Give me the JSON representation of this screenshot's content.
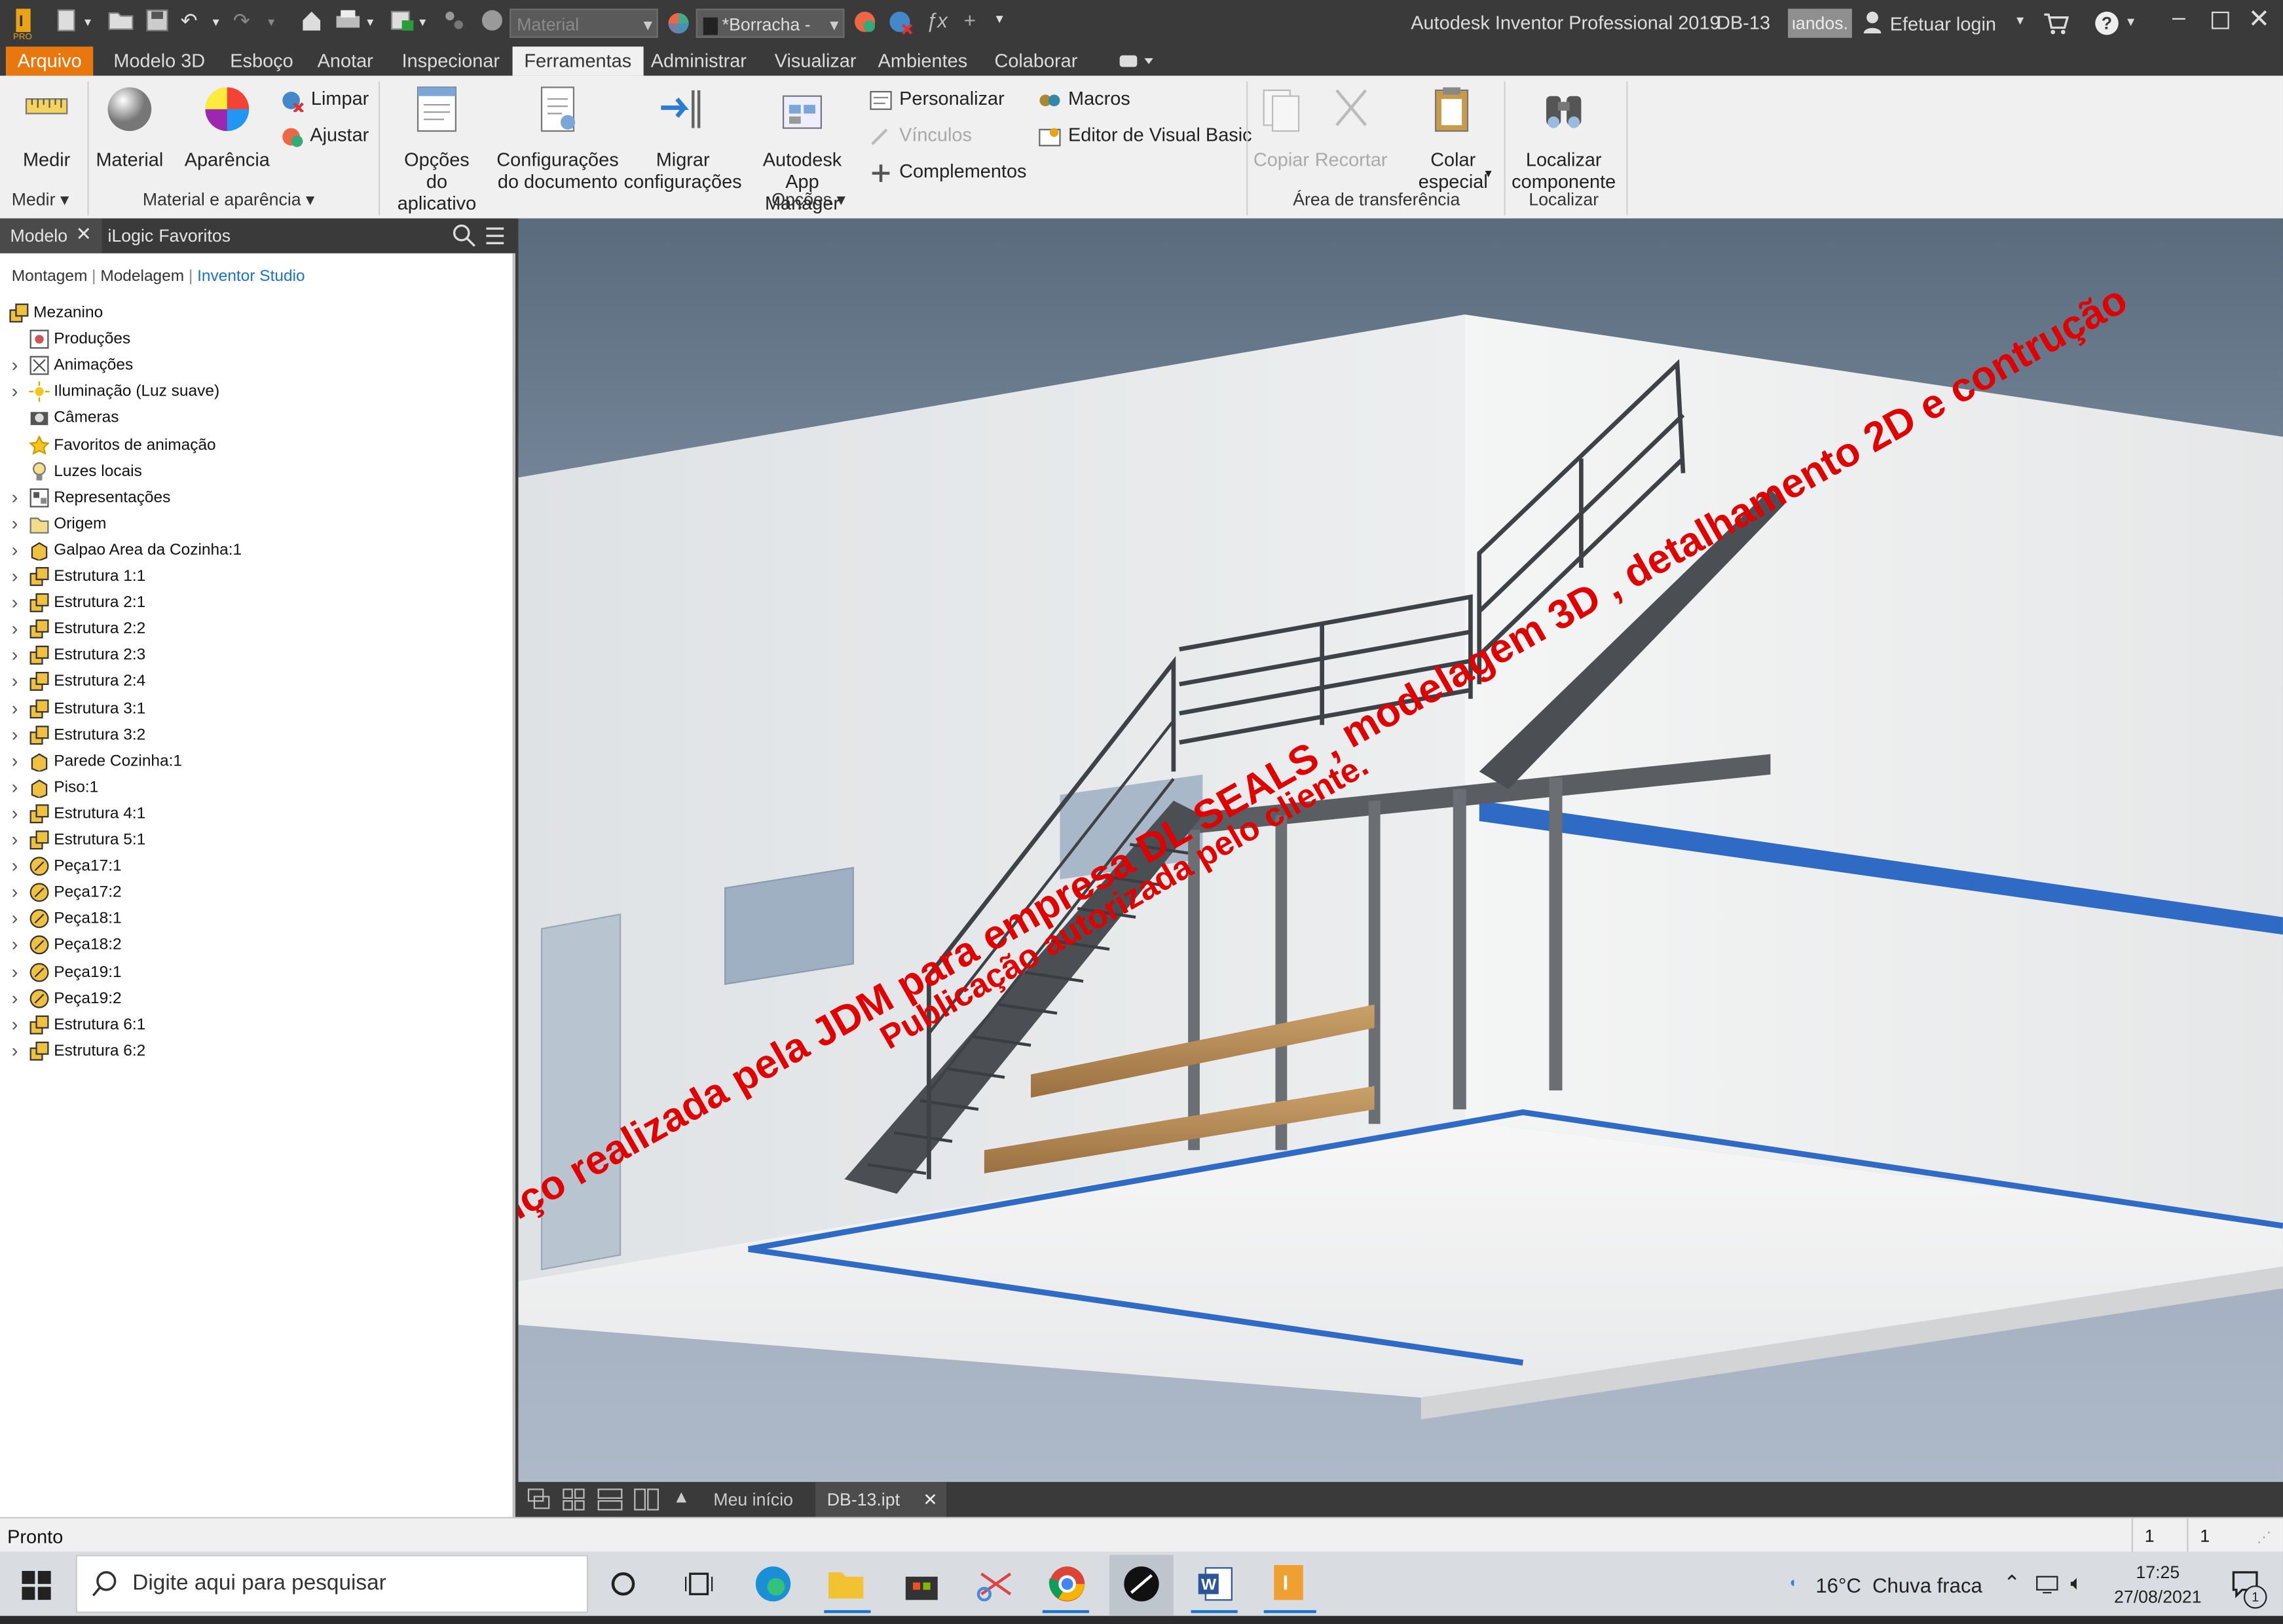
{
  "titlebar": {
    "material_placeholder": "Material",
    "appearance_value": "*Borracha -",
    "app_title": "Autodesk Inventor Professional 2019",
    "document_name": "DB-13",
    "search_text": "ιandos.",
    "login_label": "Efetuar login",
    "help_label": "?"
  },
  "tabs": [
    "Arquivo",
    "Modelo 3D",
    "Esboço",
    "Anotar",
    "Inspecionar",
    "Ferramentas",
    "Administrar",
    "Visualizar",
    "Ambientes",
    "Colaborar"
  ],
  "ribbon": {
    "measure": {
      "label": "Medir",
      "group": "Medir"
    },
    "material": {
      "label": "Material"
    },
    "appearance": {
      "label": "Aparência"
    },
    "clear": {
      "label": "Limpar"
    },
    "adjust": {
      "label": "Ajustar"
    },
    "material_group": "Material e aparência",
    "app_options": {
      "line1": "Opções",
      "line2": "do aplicativo"
    },
    "doc_settings": {
      "line1": "Configurações",
      "line2": "do documento"
    },
    "migrate": {
      "line1": "Migrar",
      "line2": "configurações"
    },
    "app_manager": {
      "line1": "Autodesk",
      "line2": "App Manager"
    },
    "customize": "Personalizar",
    "links": "Vínculos",
    "addins": "Complementos",
    "macros": "Macros",
    "vba_editor": "Editor de Visual Basic",
    "options_group": "Opções",
    "copy": "Copiar",
    "cut": "Recortar",
    "paste_special": {
      "line1": "Colar",
      "line2": "especial"
    },
    "clipboard_group": "Área de transferência",
    "find_component": {
      "line1": "Localizar",
      "line2": "componente"
    },
    "find_group": "Localizar"
  },
  "browser": {
    "tabs": [
      "Modelo",
      "iLogic",
      "Favoritos"
    ],
    "filters": [
      "Montagem",
      "Modelagem",
      "Inventor Studio"
    ],
    "items": [
      {
        "label": "Mezanino",
        "icon": "assembly-icon",
        "expand": false,
        "indent": 0
      },
      {
        "label": "Produções",
        "icon": "render-icon",
        "expand": false,
        "indent": 1
      },
      {
        "label": "Animações",
        "icon": "animation-icon",
        "expand": true,
        "indent": 1
      },
      {
        "label": "Iluminação (Luz suave)",
        "icon": "lighting-icon",
        "expand": true,
        "indent": 1
      },
      {
        "label": "Câmeras",
        "icon": "camera-icon",
        "expand": false,
        "indent": 1
      },
      {
        "label": "Favoritos de animação",
        "icon": "star-icon",
        "expand": false,
        "indent": 1
      },
      {
        "label": "Luzes locais",
        "icon": "bulb-icon",
        "expand": false,
        "indent": 1
      },
      {
        "label": "Representações",
        "icon": "representations-icon",
        "expand": true,
        "indent": 1
      },
      {
        "label": "Origem",
        "icon": "folder-icon",
        "expand": true,
        "indent": 1
      },
      {
        "label": "Galpao Area da Cozinha:1",
        "icon": "part-icon",
        "expand": true,
        "indent": 1
      },
      {
        "label": "Estrutura 1:1",
        "icon": "subassembly-icon",
        "expand": true,
        "indent": 1
      },
      {
        "label": "Estrutura 2:1",
        "icon": "subassembly-icon",
        "expand": true,
        "indent": 1
      },
      {
        "label": "Estrutura 2:2",
        "icon": "subassembly-icon",
        "expand": true,
        "indent": 1
      },
      {
        "label": "Estrutura 2:3",
        "icon": "subassembly-icon",
        "expand": true,
        "indent": 1
      },
      {
        "label": "Estrutura 2:4",
        "icon": "subassembly-icon",
        "expand": true,
        "indent": 1
      },
      {
        "label": "Estrutura 3:1",
        "icon": "subassembly-icon",
        "expand": true,
        "indent": 1
      },
      {
        "label": "Estrutura 3:2",
        "icon": "subassembly-icon",
        "expand": true,
        "indent": 1
      },
      {
        "label": "Parede Cozinha:1",
        "icon": "part-icon",
        "expand": true,
        "indent": 1
      },
      {
        "label": "Piso:1",
        "icon": "part-icon",
        "expand": true,
        "indent": 1
      },
      {
        "label": "Estrutura 4:1",
        "icon": "subassembly-icon",
        "expand": true,
        "indent": 1
      },
      {
        "label": "Estrutura 5:1",
        "icon": "subassembly-icon",
        "expand": true,
        "indent": 1
      },
      {
        "label": "Peça17:1",
        "icon": "sheetmetal-icon",
        "expand": true,
        "indent": 1
      },
      {
        "label": "Peça17:2",
        "icon": "sheetmetal-icon",
        "expand": true,
        "indent": 1
      },
      {
        "label": "Peça18:1",
        "icon": "sheetmetal-icon",
        "expand": true,
        "indent": 1
      },
      {
        "label": "Peça18:2",
        "icon": "sheetmetal-icon",
        "expand": true,
        "indent": 1
      },
      {
        "label": "Peça19:1",
        "icon": "sheetmetal-icon",
        "expand": true,
        "indent": 1
      },
      {
        "label": "Peça19:2",
        "icon": "sheetmetal-icon",
        "expand": true,
        "indent": 1
      },
      {
        "label": "Estrutura 6:1",
        "icon": "subassembly-icon",
        "expand": true,
        "indent": 1
      },
      {
        "label": "Estrutura 6:2",
        "icon": "subassembly-icon",
        "expand": true,
        "indent": 1
      }
    ]
  },
  "watermark": {
    "line1": "Prestação de Serviço realizada pela JDM para empresa DL SEALS , modelagem 3D , detalhamento 2D e contrução",
    "line2": "Publicação autorizada pelo cliente."
  },
  "doctabs": {
    "home": "Meu início",
    "document": "DB-13.ipt"
  },
  "status": {
    "text": "Pronto",
    "count1": "1",
    "count2": "1"
  },
  "taskbar": {
    "search_placeholder": "Digite aqui para pesquisar",
    "temperature": "16°C",
    "weather": "Chuva fraca",
    "time": "17:25",
    "date": "27/08/2021",
    "notifications": "1"
  },
  "colors": {
    "accent": "#e8770e",
    "highlight_blue": "#1a73c8",
    "watermark": "#e00000"
  }
}
